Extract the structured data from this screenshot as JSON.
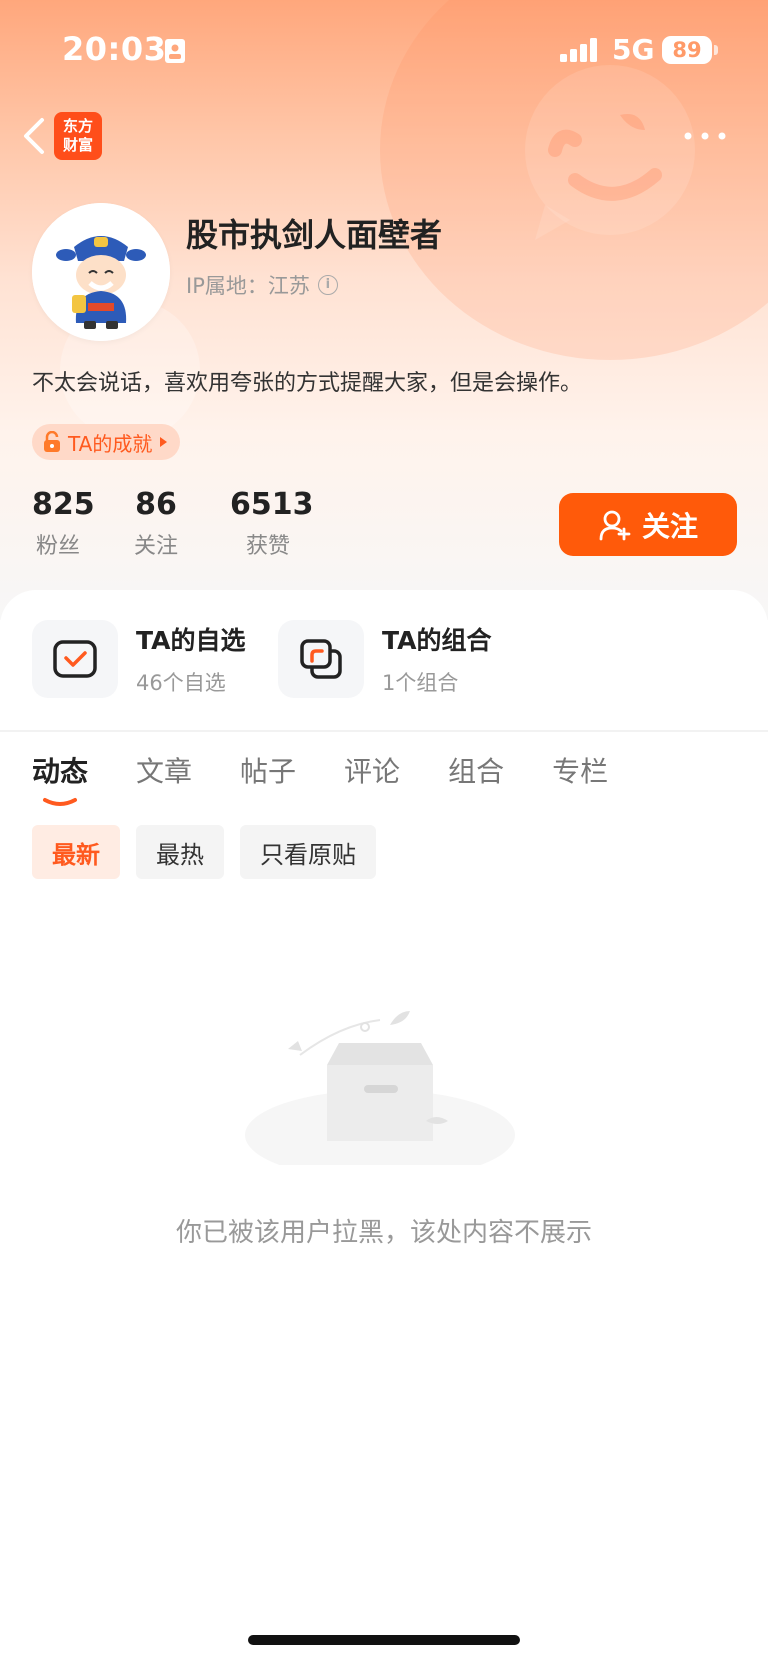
{
  "status_bar": {
    "time": "20:03",
    "network": "5G",
    "battery": "89"
  },
  "nav": {
    "logo_text_line1": "东方",
    "logo_text_line2": "财富"
  },
  "profile": {
    "username": "股市执剑人面壁者",
    "ip_location": "IP属地：江苏",
    "bio": "不太会说话，喜欢用夸张的方式提醒大家，但是会操作。",
    "badge_label": "TA的成就"
  },
  "stats": [
    {
      "value": "825",
      "label": "粉丝"
    },
    {
      "value": "86",
      "label": "关注"
    },
    {
      "value": "6513",
      "label": "获赞"
    }
  ],
  "follow_button": {
    "label": "关注"
  },
  "quick_links": [
    {
      "title": "TA的自选",
      "subtitle": "46个自选"
    },
    {
      "title": "TA的组合",
      "subtitle": "1个组合"
    }
  ],
  "tabs": [
    {
      "label": "动态",
      "active": true
    },
    {
      "label": "文章",
      "active": false
    },
    {
      "label": "帖子",
      "active": false
    },
    {
      "label": "评论",
      "active": false
    },
    {
      "label": "组合",
      "active": false
    },
    {
      "label": "专栏",
      "active": false
    }
  ],
  "filters": [
    {
      "label": "最新",
      "active": true
    },
    {
      "label": "最热",
      "active": false
    },
    {
      "label": "只看原贴",
      "active": false
    }
  ],
  "empty_state": {
    "message": "你已被该用户拉黑，该处内容不展示"
  },
  "colors": {
    "accent": "#ff5a0a",
    "badge_bg": "#ffd9c8"
  }
}
